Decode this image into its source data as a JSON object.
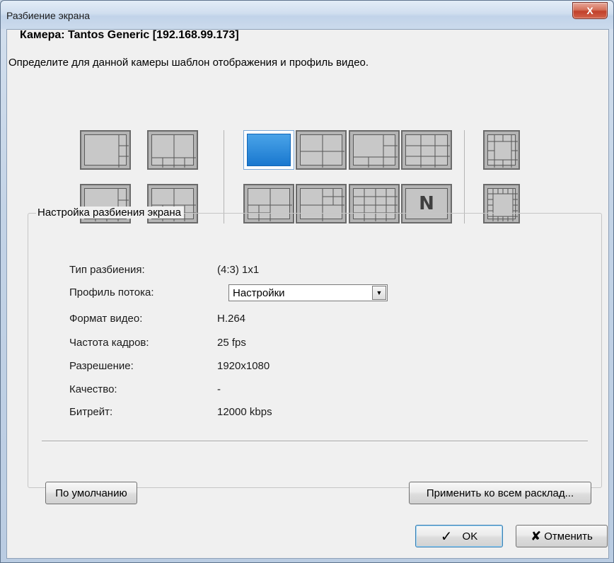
{
  "window": {
    "title": "Разбиение экрана",
    "close_label": "X"
  },
  "header": {
    "camera_title": "Камера: Tantos Generic [192.168.99.173]",
    "instruction": "Определите для данной камеры шаблон отображения и профиль видео."
  },
  "layout_tiles": {
    "selected_layout": "1x1",
    "n_label": "N"
  },
  "settings": {
    "legend": "Настройка разбиения экрана",
    "rows": [
      {
        "label": "Тип разбиения:",
        "value": "(4:3) 1x1"
      },
      {
        "label": "Профиль потока:",
        "value": "Настройки"
      },
      {
        "label": "Формат видео:",
        "value": "H.264"
      },
      {
        "label": "Частота кадров:",
        "value": "25 fps"
      },
      {
        "label": "Разрешение:",
        "value": "1920x1080"
      },
      {
        "label": "Качество:",
        "value": "-"
      },
      {
        "label": "Битрейт:",
        "value": "12000 kbps"
      }
    ],
    "default_button": "По умолчанию",
    "apply_all_button": "Применить ко всем расклад..."
  },
  "footer": {
    "ok_label": "OK",
    "cancel_label": "Отменить"
  },
  "colors": {
    "selected_tile": "#1978cf",
    "dialog_bg": "#f0f0f0"
  }
}
